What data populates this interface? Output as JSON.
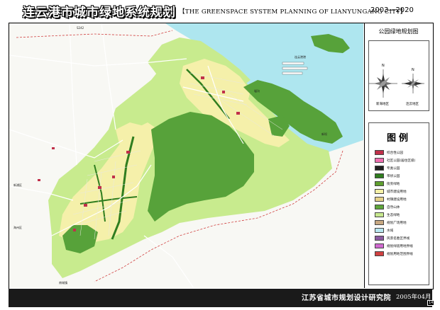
{
  "header": {
    "title_cn": "连云港市城市绿地系统规划",
    "dash": "——",
    "title_en": "【THE GREENSPACE SYSTEM PLANNING OF LIANYUNGANG CITY】",
    "years": "2003—2020"
  },
  "index_map": {
    "title": "公园绿地规划图",
    "north": "N",
    "district_left": "新海地区",
    "district_right": "连云地区"
  },
  "legend": {
    "title": "图例",
    "items": [
      {
        "label": "综合性公园",
        "color": "#c0304a"
      },
      {
        "label": "社区公园(居住区级)",
        "color": "#ef6fb0"
      },
      {
        "label": "专类公园",
        "color": "#1f1f1f"
      },
      {
        "label": "带状公园",
        "color": "#2f7d1f"
      },
      {
        "label": "街旁绿地",
        "color": "#5f9f2f"
      },
      {
        "label": "城市建设用地",
        "color": "#f6f1a8"
      },
      {
        "label": "村镇建设用地",
        "color": "#e6d28a"
      },
      {
        "label": "自然山体",
        "color": "#5ea53a"
      },
      {
        "label": "生态绿地",
        "color": "#c7e88e"
      },
      {
        "label": "规划广场用地",
        "color": "#c8a882"
      },
      {
        "label": "水域",
        "color": "#b8e7f0"
      },
      {
        "label": "风景名胜区界线",
        "color": "#8a5aa0"
      },
      {
        "label": "规划绿道用地界线",
        "color": "#d06ad0"
      },
      {
        "label": "规划用地范围界线",
        "color": "#d04040"
      }
    ]
  },
  "map": {
    "colors": {
      "sea": "#aee6ef",
      "eco_green": "#c8eb8e",
      "mountain": "#57a23a",
      "built": "#f5f0aa",
      "road": "#ffffff",
      "park_red": "#c0304a",
      "strip_park": "#2f7d1f"
    },
    "labels": [
      {
        "id": "port-label",
        "text": "连云港港"
      },
      {
        "id": "xugou-label",
        "text": "墟沟"
      },
      {
        "id": "ganyu-label",
        "text": "新坝"
      },
      {
        "id": "north-road-label",
        "text": "S242"
      },
      {
        "id": "west-label-1",
        "text": "新浦区"
      },
      {
        "id": "west-label-2",
        "text": "海州区"
      },
      {
        "id": "south-label",
        "text": "南城镇"
      }
    ]
  },
  "footer": {
    "org": "江苏省城市规划设计研究院",
    "date": "2005年04月",
    "page": "14"
  }
}
